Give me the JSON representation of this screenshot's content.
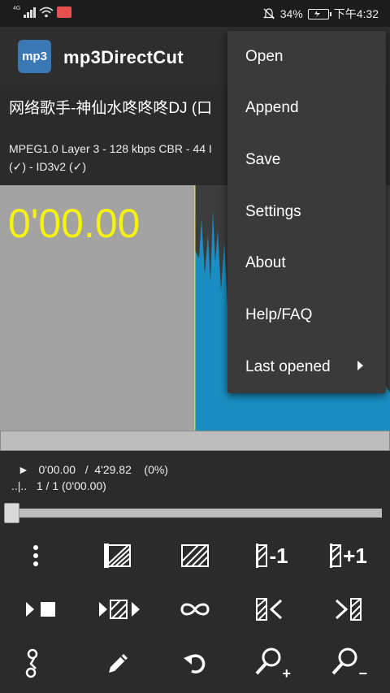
{
  "status_bar": {
    "network_label": "4G",
    "mute_icon": "bell-off-icon",
    "battery_percent": "34%",
    "time": "下午4:32"
  },
  "app": {
    "title": "mp3DirectCut",
    "logo_text": "mp3"
  },
  "track": {
    "title": "网络歌手-神仙水咚咚咚DJ (口",
    "format_line1": "MPEG1.0 Layer 3 - 128 kbps CBR - 44 I",
    "format_line2": "(✓) - ID3v2 (✓)"
  },
  "waveform": {
    "current_time": "0'00.00",
    "selection_color": "#a3a3a3",
    "wave_color": "#1a8ec2",
    "cursor_color": "#d6d04a"
  },
  "position": {
    "line1": "►   0'00.00   /  4'29.82    (0%)",
    "line2": "..|..   1 / 1 (0'00.00)",
    "slider_progress": 0.0
  },
  "toolbar": {
    "row1": [
      "more-vertical-icon",
      "select-left-icon",
      "select-all-icon",
      "cut-minus-one-icon",
      "cut-plus-one-icon"
    ],
    "row1_texts": [
      "",
      "",
      "",
      "-1",
      "+1"
    ],
    "row2": [
      "play-stop-icon",
      "play-selection-icon",
      "loop-icon",
      "go-to-start-icon",
      "go-to-end-icon"
    ],
    "row3": [
      "split-icon",
      "edit-pencil-icon",
      "undo-icon",
      "zoom-in-icon",
      "zoom-out-icon"
    ],
    "zoom_in_sign": "+",
    "zoom_out_sign": "−"
  },
  "menu": {
    "items": [
      {
        "label": "Open"
      },
      {
        "label": "Append"
      },
      {
        "label": "Save"
      },
      {
        "label": "Settings"
      },
      {
        "label": "About"
      },
      {
        "label": "Help/FAQ"
      },
      {
        "label": "Last opened",
        "submenu": true
      }
    ]
  }
}
